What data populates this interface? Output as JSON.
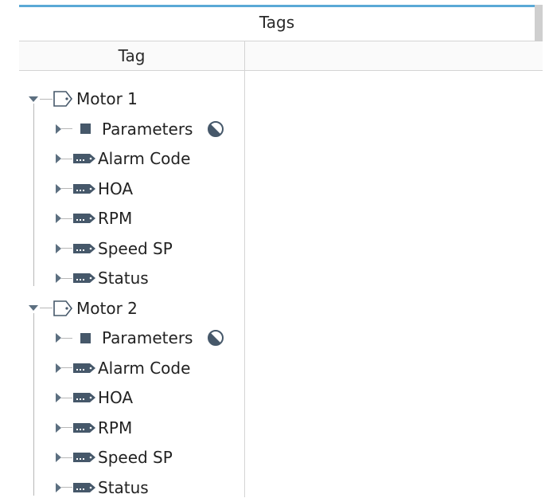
{
  "panel": {
    "title": "Tags"
  },
  "table": {
    "columns": [
      "Tag",
      ""
    ]
  },
  "tree": [
    {
      "label": "Motor 1",
      "icon": "udt-instance-icon",
      "expanded": true,
      "children": [
        {
          "label": "Parameters",
          "icon": "folder-square-icon",
          "status_icon": "half-circle-icon"
        },
        {
          "label": "Alarm Code",
          "icon": "tag-icon"
        },
        {
          "label": "HOA",
          "icon": "tag-icon"
        },
        {
          "label": "RPM",
          "icon": "tag-icon"
        },
        {
          "label": "Speed SP",
          "icon": "tag-icon"
        },
        {
          "label": "Status",
          "icon": "tag-icon"
        }
      ]
    },
    {
      "label": "Motor 2",
      "icon": "udt-instance-icon",
      "expanded": true,
      "children": [
        {
          "label": "Parameters",
          "icon": "folder-square-icon",
          "status_icon": "half-circle-icon"
        },
        {
          "label": "Alarm Code",
          "icon": "tag-icon"
        },
        {
          "label": "HOA",
          "icon": "tag-icon"
        },
        {
          "label": "RPM",
          "icon": "tag-icon"
        },
        {
          "label": "Speed SP",
          "icon": "tag-icon"
        },
        {
          "label": "Status",
          "icon": "tag-icon"
        }
      ]
    }
  ],
  "colors": {
    "accent": "#5aa9d6",
    "icon": "#46586a",
    "arrow": "#5c6f80"
  }
}
